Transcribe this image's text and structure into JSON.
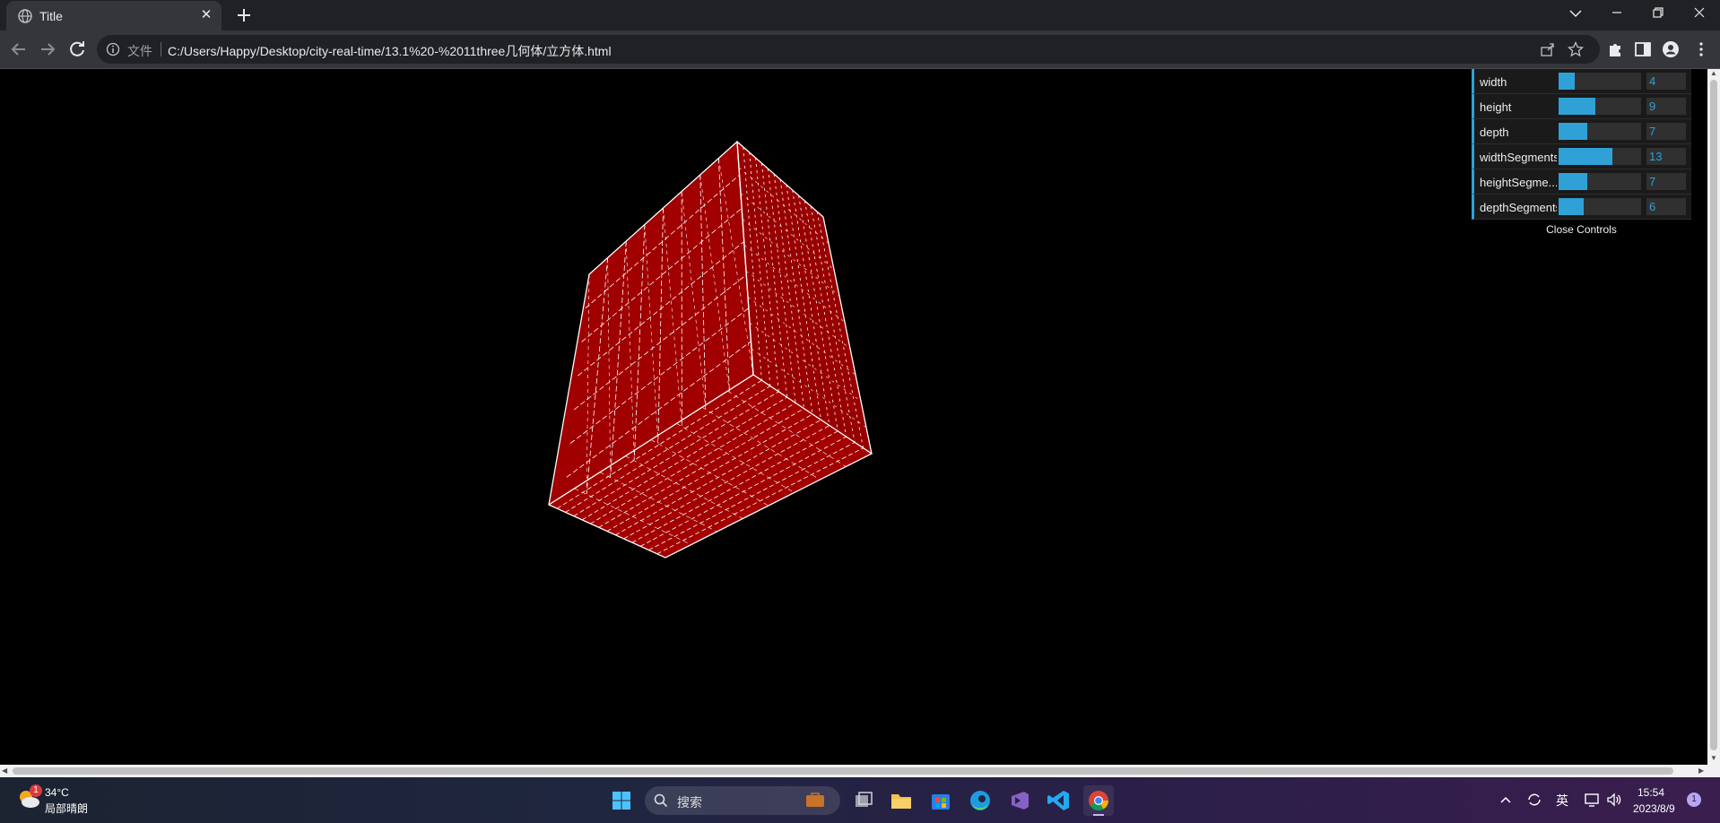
{
  "browser": {
    "tab_title": "Title",
    "tab_close": "✕",
    "new_tab": "+",
    "address": {
      "file_label": "文件",
      "url": "C:/Users/Happy/Desktop/city-real-time/13.1%20-%2011three几何体/立方体.html"
    }
  },
  "gui": {
    "controls": [
      {
        "label": "width",
        "value": "4",
        "fill": 0.2
      },
      {
        "label": "height",
        "value": "9",
        "fill": 0.45
      },
      {
        "label": "depth",
        "value": "7",
        "fill": 0.35
      },
      {
        "label": "widthSegments",
        "value": "13",
        "fill": 0.65
      },
      {
        "label": "heightSegme...",
        "value": "7",
        "fill": 0.35
      },
      {
        "label": "depthSegments",
        "value": "6",
        "fill": 0.3
      }
    ],
    "close_label": "Close Controls",
    "accent": "#2fa1d6"
  },
  "scene": {
    "box_color": "#a00000",
    "wire_color": "#ffffff"
  },
  "taskbar": {
    "weather_badge": "1",
    "temperature": "34°C",
    "condition": "局部晴朗",
    "search_label": "搜索",
    "ime": "英",
    "time": "15:54",
    "date": "2023/8/9",
    "notifications": "1"
  }
}
